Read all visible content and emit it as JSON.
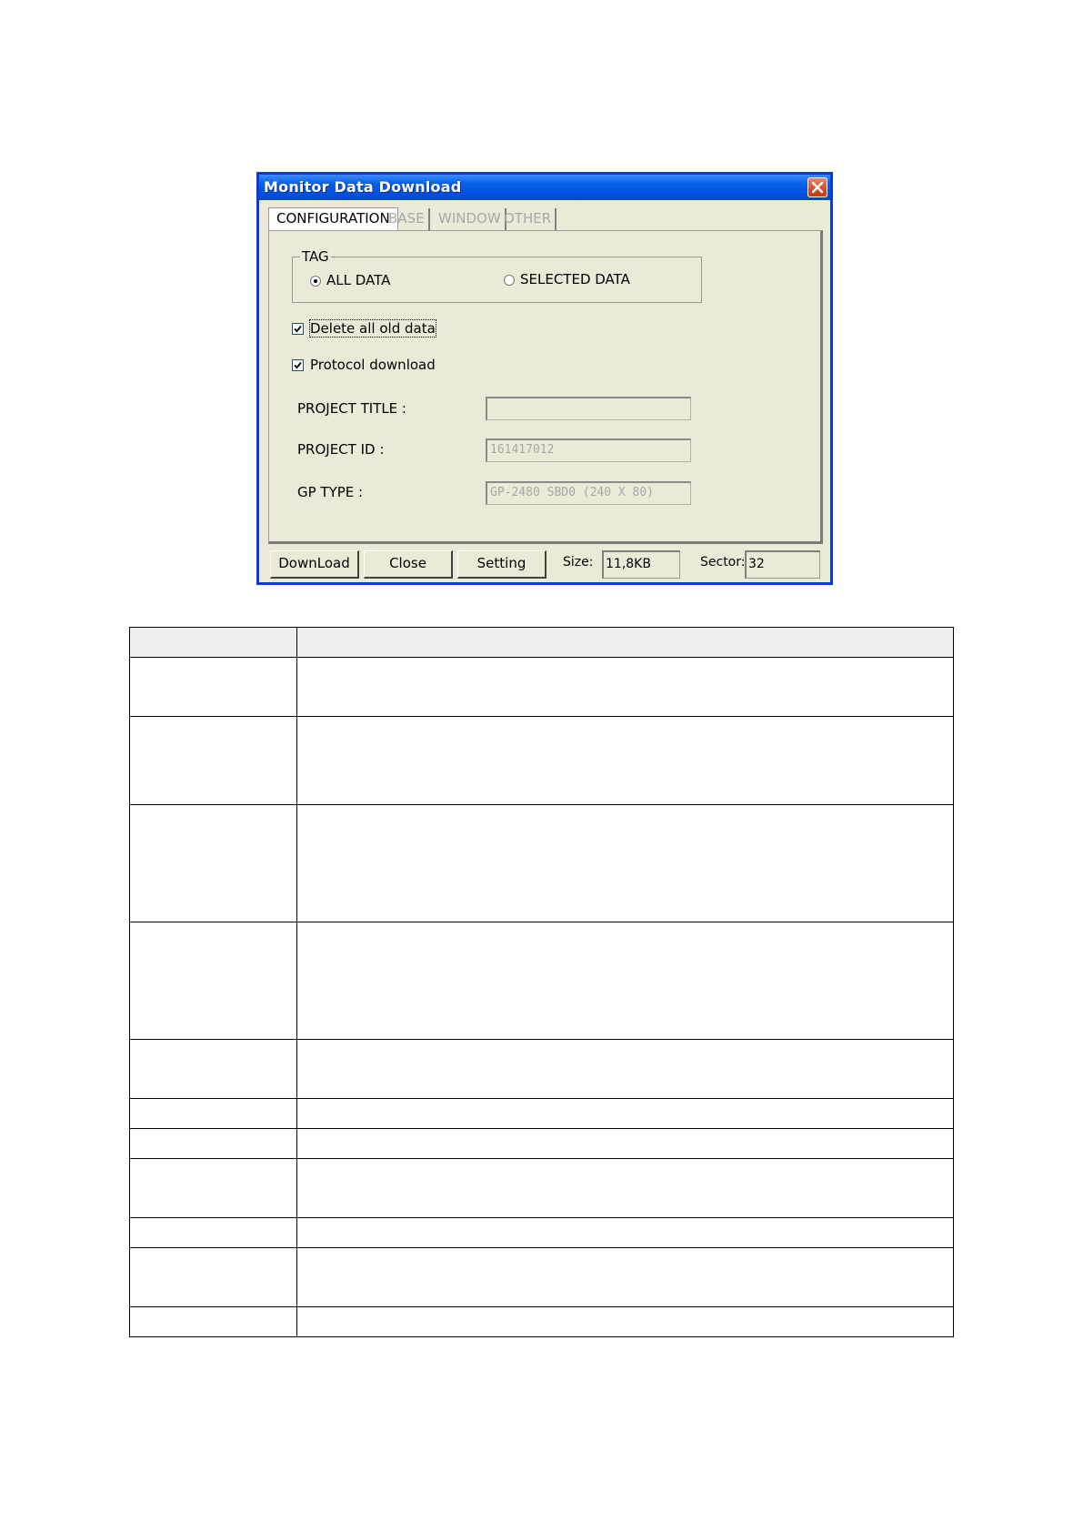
{
  "dialog": {
    "title": "Monitor Data Download",
    "tabs": [
      {
        "label": "CONFIGURATION",
        "active": true
      },
      {
        "label": "BASE",
        "active": false
      },
      {
        "label": "WINDOW",
        "active": false
      },
      {
        "label": "OTHER",
        "active": false
      }
    ],
    "tag_group": {
      "label": "TAG",
      "all_data_label": "ALL DATA",
      "selected_data_label": "SELECTED DATA",
      "selected_option": "ALL DATA"
    },
    "delete_old": {
      "label": "Delete all old data",
      "checked": true
    },
    "protocol": {
      "label": "Protocol download",
      "checked": true
    },
    "fields": {
      "project_title_label": "PROJECT TITLE  :",
      "project_title_value": "",
      "project_id_label": "PROJECT ID  :",
      "project_id_value": "161417012",
      "gp_type_label": "GP TYPE  :",
      "gp_type_value": "GP-2480  SBD0  (240 X 80)"
    },
    "buttons": {
      "download": "DownLoad",
      "close": "Close",
      "setting": "Setting"
    },
    "status": {
      "size_label": "Size:",
      "size_value": "11,8KB",
      "sector_label": "Sector:",
      "sector_value": "32"
    }
  },
  "colors": {
    "titlebar": "#0053e0",
    "dialog_bg": "#ece9d8",
    "close_button": "#d64a24",
    "disabled_text": "#a8a8a8"
  },
  "table": {
    "header": [
      "",
      ""
    ],
    "rows": [
      [
        "",
        ""
      ],
      [
        "",
        ""
      ],
      [
        "",
        ""
      ],
      [
        "",
        ""
      ],
      [
        "",
        ""
      ],
      [
        "",
        ""
      ],
      [
        "",
        ""
      ],
      [
        "",
        ""
      ],
      [
        "",
        ""
      ],
      [
        "",
        ""
      ],
      [
        "",
        ""
      ]
    ]
  }
}
